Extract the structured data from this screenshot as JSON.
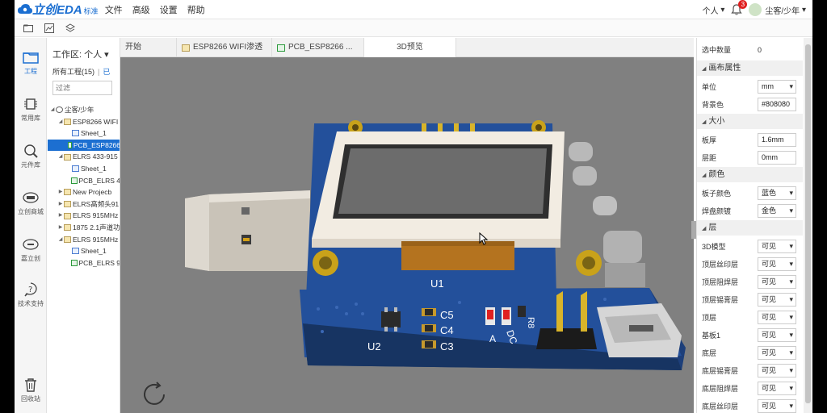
{
  "app": {
    "logo_text": "立创EDA",
    "edition": "标准",
    "menu": [
      "文件",
      "高级",
      "设置",
      "帮助"
    ]
  },
  "topright": {
    "personal": "个人",
    "notifications": "3",
    "username": "尘客/少年"
  },
  "leftnav": [
    {
      "label": "工程",
      "icon": "folder-icon"
    },
    {
      "label": "常用库",
      "icon": "chip-icon"
    },
    {
      "label": "元件库",
      "icon": "search-icon"
    },
    {
      "label": "立创商城",
      "icon": "lcsc-icon"
    },
    {
      "label": "嘉立创",
      "icon": "jlc-icon"
    },
    {
      "label": "技术支持",
      "icon": "help-icon"
    },
    {
      "label": "回收站",
      "icon": "trash-icon"
    }
  ],
  "project_panel": {
    "workspace_label": "工作区: 个人",
    "all_projects": "所有工程(15)",
    "link_text": "已",
    "filter_placeholder": "过滤",
    "tree": [
      {
        "label": "尘客/少年",
        "type": "user",
        "level": 0,
        "expanded": true
      },
      {
        "label": "ESP8266 WIFI",
        "type": "folder",
        "level": 1,
        "expanded": true
      },
      {
        "label": "Sheet_1",
        "type": "sch",
        "level": 2
      },
      {
        "label": "PCB_ESP8266",
        "type": "pcb",
        "level": 2,
        "selected": true
      },
      {
        "label": "ELRS 433-915",
        "type": "folder",
        "level": 1,
        "expanded": true
      },
      {
        "label": "Sheet_1",
        "type": "sch",
        "level": 2
      },
      {
        "label": "PCB_ELRS 4",
        "type": "pcb",
        "level": 2
      },
      {
        "label": "New Projecb",
        "type": "folder",
        "level": 1,
        "expanded": false
      },
      {
        "label": "ELRS高频头91",
        "type": "folder",
        "level": 1,
        "expanded": false
      },
      {
        "label": "ELRS 915MHz",
        "type": "folder",
        "level": 1,
        "expanded": false
      },
      {
        "label": "1875 2.1声道功",
        "type": "folder",
        "level": 1,
        "expanded": false
      },
      {
        "label": "ELRS 915MHz",
        "type": "folder",
        "level": 1,
        "expanded": true
      },
      {
        "label": "Sheet_1",
        "type": "sch",
        "level": 2
      },
      {
        "label": "PCB_ELRS 9",
        "type": "pcb",
        "level": 2
      }
    ]
  },
  "tabs": [
    {
      "label": "开始",
      "icon": "",
      "active": false
    },
    {
      "label": "ESP8266 WIFI渗透",
      "icon": "folder",
      "active": false
    },
    {
      "label": "PCB_ESP8266 ...",
      "icon": "pcb",
      "active": false
    },
    {
      "label": "3D预览",
      "icon": "",
      "active": true
    }
  ],
  "view3d": {
    "background": "#808080",
    "silkscreen": [
      "U1",
      "U2",
      "C5",
      "C4",
      "C3",
      "R8",
      "A",
      "DC"
    ]
  },
  "properties": {
    "selected_count_label": "选中数量",
    "selected_count": "0",
    "sections": [
      {
        "title": "画布属性",
        "rows": [
          {
            "label": "单位",
            "value": "mm",
            "select": true
          },
          {
            "label": "背景色",
            "value": "#808080",
            "color": true
          }
        ]
      },
      {
        "title": "大小",
        "rows": [
          {
            "label": "板厚",
            "value": "1.6mm",
            "select": false
          },
          {
            "label": "层距",
            "value": "0mm",
            "select": false
          }
        ]
      },
      {
        "title": "颜色",
        "rows": [
          {
            "label": "板子颜色",
            "value": "蓝色",
            "select": true
          },
          {
            "label": "焊盘颜镀",
            "value": "金色",
            "select": true
          }
        ]
      },
      {
        "title": "层",
        "rows": [
          {
            "label": "3D模型",
            "value": "可见",
            "select": true
          },
          {
            "label": "顶层丝印层",
            "value": "可见",
            "select": true
          },
          {
            "label": "顶层阻焊层",
            "value": "可见",
            "select": true
          },
          {
            "label": "顶层锡膏层",
            "value": "可见",
            "select": true
          },
          {
            "label": "顶层",
            "value": "可见",
            "select": true
          },
          {
            "label": "基板1",
            "value": "可见",
            "select": true
          },
          {
            "label": "底层",
            "value": "可见",
            "select": true
          },
          {
            "label": "底层锡膏层",
            "value": "可见",
            "select": true
          },
          {
            "label": "底层阻焊层",
            "value": "可见",
            "select": true
          },
          {
            "label": "底层丝印层",
            "value": "可见",
            "select": true
          }
        ]
      }
    ]
  }
}
